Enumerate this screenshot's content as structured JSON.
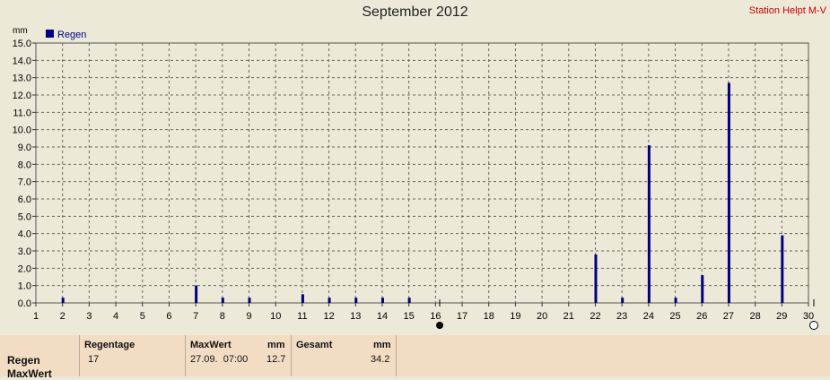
{
  "header": {
    "title": "September 2012",
    "station": "Station Helpt M-V"
  },
  "chart_data": {
    "type": "bar",
    "title": "September 2012",
    "ylabel": "mm",
    "ylim": [
      0,
      15
    ],
    "yticks": [
      "0.0",
      "1.0",
      "2.0",
      "3.0",
      "4.0",
      "5.0",
      "6.0",
      "7.0",
      "8.0",
      "9.0",
      "10.0",
      "11.0",
      "12.0",
      "13.0",
      "14.0",
      "15.0"
    ],
    "xlim": [
      1,
      30
    ],
    "xticks": [
      "1",
      "2",
      "3",
      "4",
      "5",
      "6",
      "7",
      "8",
      "9",
      "10",
      "11",
      "12",
      "13",
      "14",
      "15",
      "16",
      "17",
      "18",
      "19",
      "20",
      "21",
      "22",
      "23",
      "24",
      "25",
      "26",
      "27",
      "28",
      "29",
      "30"
    ],
    "grid": true,
    "legend": "top-left",
    "series": [
      {
        "name": "Regen",
        "color": "#000080",
        "x": [
          2,
          7,
          8,
          9,
          11,
          12,
          13,
          14,
          15,
          22,
          23,
          24,
          25,
          26,
          27,
          29
        ],
        "values": [
          0.3,
          1.0,
          0.3,
          0.3,
          0.5,
          0.3,
          0.3,
          0.3,
          0.3,
          2.8,
          0.3,
          9.1,
          0.3,
          1.6,
          12.7,
          3.9
        ]
      }
    ]
  },
  "summary": {
    "row_labels": [
      "Regen",
      "MaxWert"
    ],
    "regentage_label": "Regentage",
    "regentage_value": "17",
    "maxwert_label": "MaxWert",
    "maxwert_unit": "mm",
    "maxwert_date": "27.09.  07:00",
    "maxwert_value": "12.7",
    "gesamt_label": "Gesamt",
    "gesamt_unit": "mm",
    "gesamt_value": "34.2"
  }
}
